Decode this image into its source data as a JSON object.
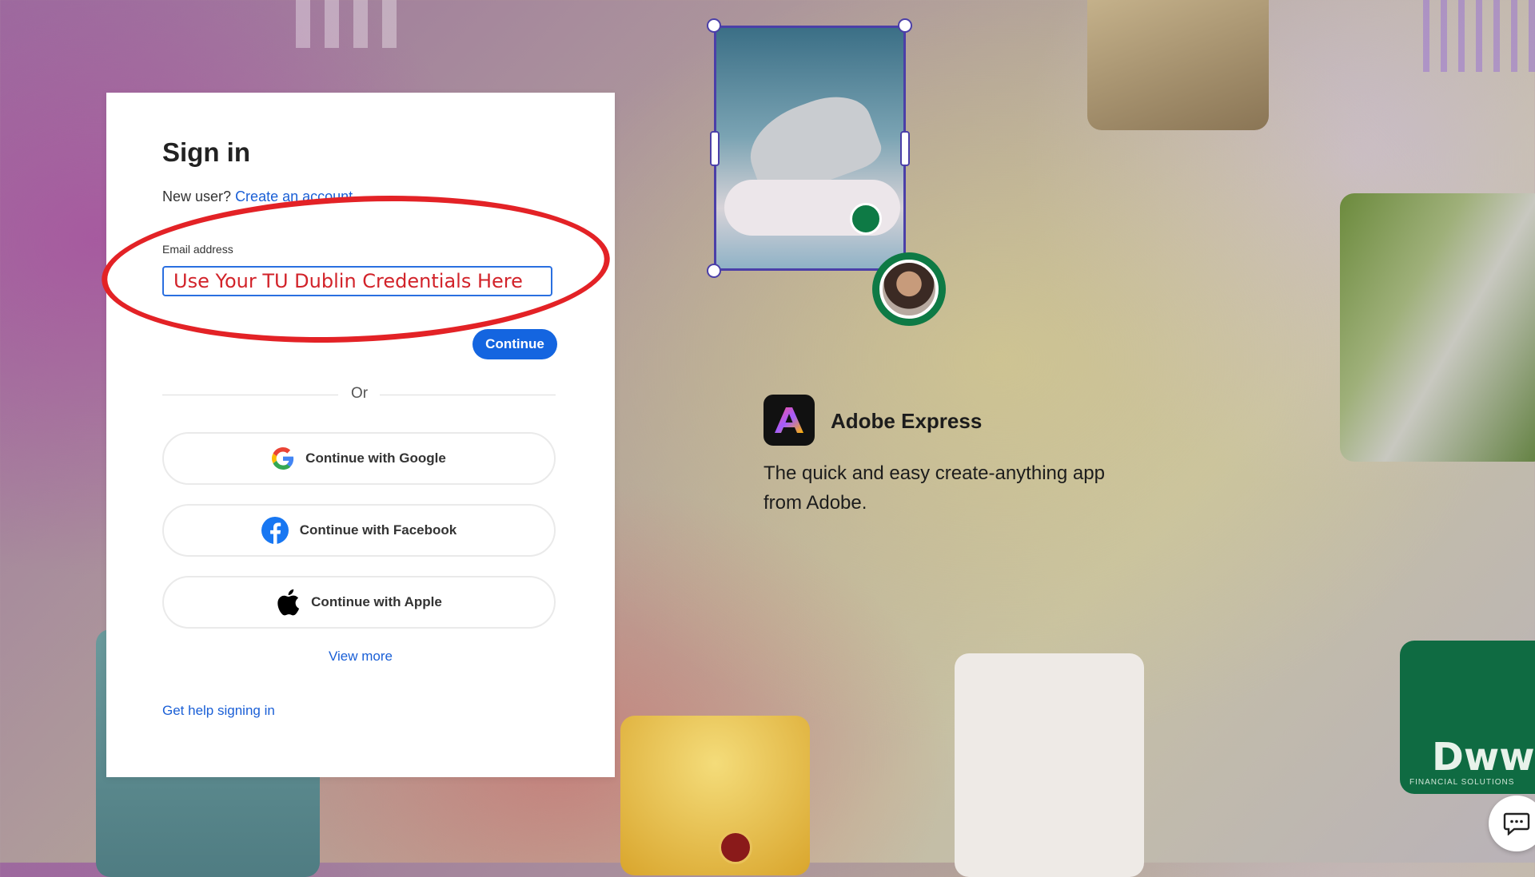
{
  "signin": {
    "title": "Sign in",
    "new_user_text": "New user?",
    "create_account_link": "Create an account",
    "email_label": "Email address",
    "email_value": "Use Your TU Dublin Credentials Here",
    "continue_label": "Continue",
    "or_text": "Or",
    "social_buttons": [
      {
        "label": "Continue with Google",
        "icon": "google-icon"
      },
      {
        "label": "Continue with Facebook",
        "icon": "facebook-icon"
      },
      {
        "label": "Continue with Apple",
        "icon": "apple-icon"
      }
    ],
    "view_more_link": "View more",
    "help_link": "Get help signing in"
  },
  "promo": {
    "app_name": "Adobe Express",
    "description": "The quick and easy create-anything app from Adobe.",
    "logo_letter": "A"
  },
  "decor": {
    "logo_tile_text": "Dww",
    "logo_tile_subtext": "FINANCIAL SOLUTIONS"
  },
  "colors": {
    "accent": "#1465e0",
    "link": "#1a5fd6",
    "annotation": "#e32226",
    "annotation_text": "#d2232a"
  }
}
